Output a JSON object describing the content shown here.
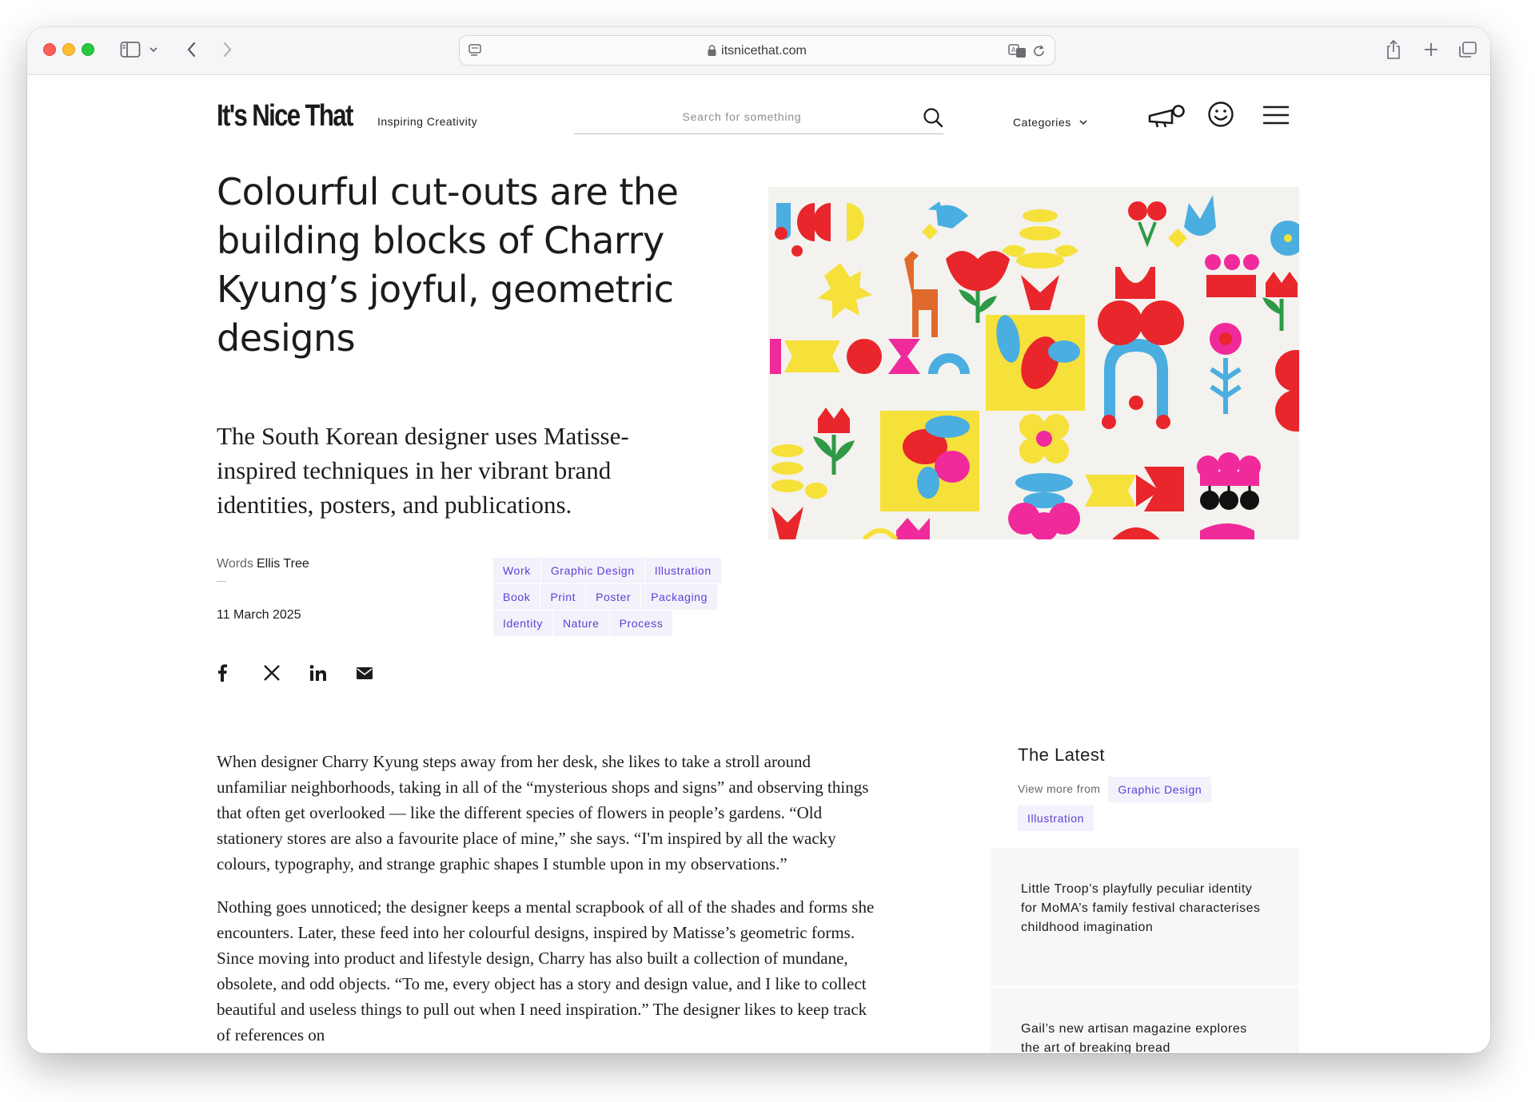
{
  "browser": {
    "url": "itsnicethat.com"
  },
  "header": {
    "logo": "It's Nice That",
    "tagline": "Inspiring Creativity",
    "search_placeholder": "Search for something",
    "categories_label": "Categories"
  },
  "article": {
    "headline": "Colourful cut-outs are the building blocks of Charry Kyung’s joyful, geometric designs",
    "standfirst": "The South Korean designer uses Matisse-inspired techniques in her vibrant brand identities, posters, and publications.",
    "byline_label": "Words",
    "author": "Ellis Tree",
    "date": "11 March 2025",
    "tag_rows": [
      [
        "Work",
        "Graphic Design",
        "Illustration"
      ],
      [
        "Book",
        "Print",
        "Poster",
        "Packaging"
      ],
      [
        "Identity",
        "Nature",
        "Process"
      ]
    ],
    "body": [
      "When designer Charry Kyung steps away from her desk, she likes to take a stroll around unfamiliar neighborhoods, taking in all of the “mysterious shops and signs” and observing things that often get overlooked — like the different species of flowers in people’s gardens. “Old stationery stores are also a favourite place of mine,” she says. “I'm inspired by all the wacky colours, typography, and strange graphic shapes I stumble upon in my observations.”",
      "Nothing goes unnoticed; the designer keeps a mental scrapbook of all of the shades and forms she encounters. Later, these feed into her colourful designs, inspired by Matisse’s geometric forms. Since moving into product and lifestyle design, Charry has also built a collection of mundane, obsolete, and odd objects. “To me, every object has a story and design value, and I like to collect beautiful and useless things to pull out when I need inspiration.” The designer likes to keep track of references on"
    ]
  },
  "sidebar": {
    "title": "The Latest",
    "view_more_label": "View more from",
    "view_more_tags": [
      "Graphic Design",
      "Illustration"
    ],
    "cards": [
      "Little Troop’s playfully peculiar identity for MoMA’s family festival characterises childhood imagination",
      "Gail’s new artisan magazine explores the art of breaking bread"
    ]
  },
  "colors": {
    "tag_bg": "#f3f1fa",
    "tag_text": "#5e3ed8",
    "red": "#e8262b",
    "yellow": "#f6e03a",
    "blue": "#4aaee0",
    "pink": "#f02a9a"
  }
}
